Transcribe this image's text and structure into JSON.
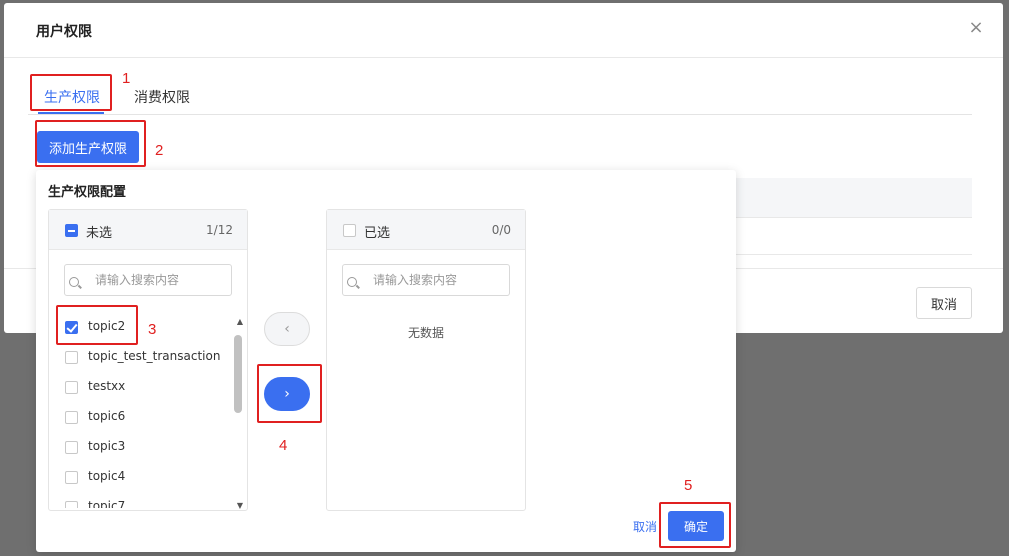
{
  "modal": {
    "title": "用户权限",
    "close_glyph": "×",
    "tabs": [
      {
        "label": "生产权限",
        "active": true
      },
      {
        "label": "消费权限",
        "active": false
      }
    ],
    "add_button_label": "添加生产权限",
    "cancel_label": "取消"
  },
  "popover": {
    "title": "生产权限配置",
    "source": {
      "header_label": "未选",
      "count": "1/12",
      "search_placeholder": "请输入搜索内容",
      "items": [
        {
          "label": "topic2",
          "checked": true
        },
        {
          "label": "topic_test_transaction",
          "checked": false
        },
        {
          "label": "testxx",
          "checked": false
        },
        {
          "label": "topic6",
          "checked": false
        },
        {
          "label": "topic3",
          "checked": false
        },
        {
          "label": "topic4",
          "checked": false
        },
        {
          "label": "topic7",
          "checked": false
        }
      ]
    },
    "target": {
      "header_label": "已选",
      "count": "0/0",
      "search_placeholder": "请输入搜索内容",
      "empty_text": "无数据"
    },
    "move_left_glyph": "‹",
    "move_right_glyph": "›",
    "cancel_label": "取消",
    "ok_label": "确定"
  },
  "annotations": {
    "one": "1",
    "two": "2",
    "three": "3",
    "four": "4",
    "five": "5"
  },
  "colors": {
    "accent": "#3a6ff0",
    "annotation": "#e02020"
  }
}
